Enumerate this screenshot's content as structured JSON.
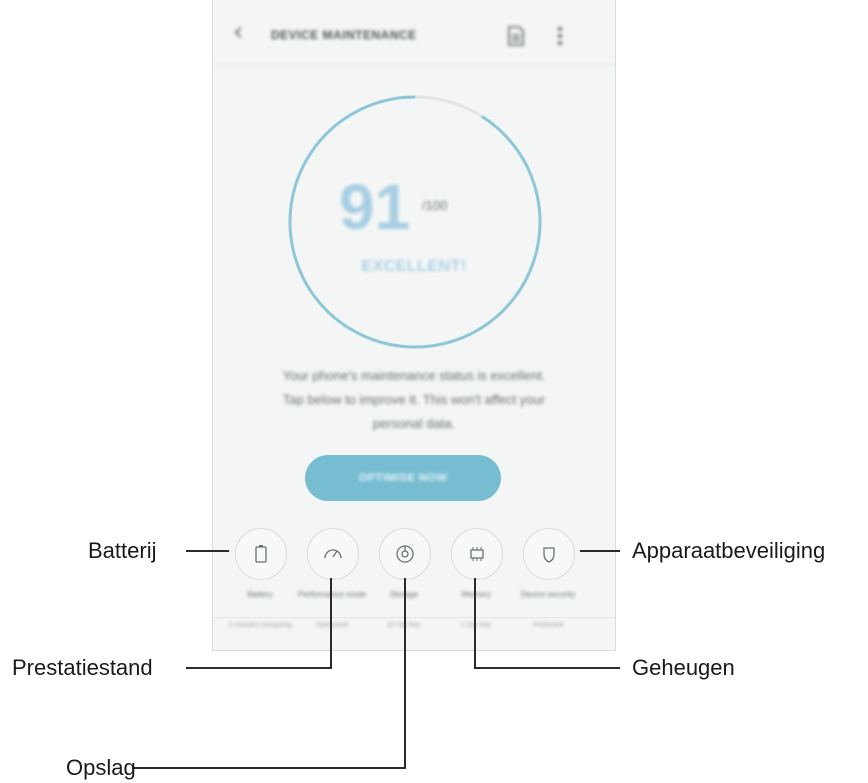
{
  "appbar": {
    "title": "DEVICE MAINTENANCE",
    "back_icon": "chevron-left-icon",
    "doc_icon": "document-icon",
    "more_icon": "more-vert-icon"
  },
  "score": {
    "value": "91",
    "denominator": "/100",
    "status": "EXCELLENT!",
    "ring_fill": 0.91
  },
  "message": {
    "line1": "Your phone's maintenance status is excellent.",
    "line2": "Tap below to improve it. This won't affect your",
    "line3": "personal data."
  },
  "optimize_button": "OPTIMISE NOW",
  "features": [
    {
      "label": "Battery",
      "sub": "2 minutes remaining",
      "icon": "battery-icon"
    },
    {
      "label": "Performance mode",
      "sub": "Optimised",
      "icon": "speedometer-icon"
    },
    {
      "label": "Storage",
      "sub": "22 GB free",
      "icon": "storage-icon"
    },
    {
      "label": "Memory",
      "sub": "1 GB free",
      "icon": "memory-chip-icon"
    },
    {
      "label": "Device security",
      "sub": "Protected",
      "icon": "shield-icon"
    }
  ],
  "callouts": {
    "battery": "Batterij",
    "performance": "Prestatiestand",
    "storage": "Opslag",
    "memory": "Geheugen",
    "security": "Apparaatbeveiliging"
  },
  "colors": {
    "accent": "#76bdd1",
    "ring": "#8ec6da",
    "ring_track": "#e1e5e5"
  }
}
